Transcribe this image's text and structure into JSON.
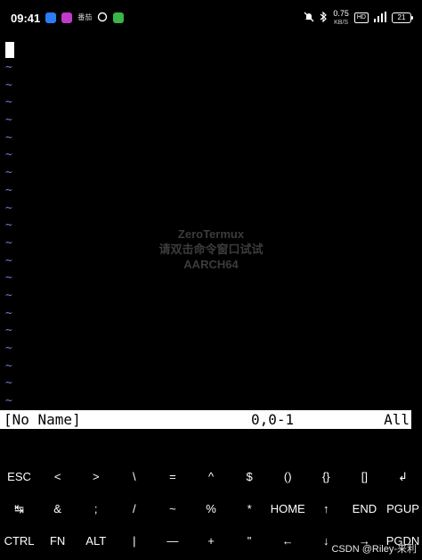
{
  "status_bar": {
    "time": "09:41",
    "notif_text": "番茄",
    "net_speed_value": "0.75",
    "net_speed_unit": "KB/S",
    "hd_badge": "HD",
    "battery_level": "21"
  },
  "editor": {
    "tilde_char": "~",
    "tilde_rows": 20,
    "watermark": {
      "line1": "ZeroTermux",
      "line2": "请双击命令窗口试试",
      "line3": "AARCH64"
    },
    "status_line": {
      "file_name": "[No Name]",
      "position": "0,0-1",
      "scroll": "All"
    }
  },
  "extra_keys": {
    "row1": [
      "ESC",
      "<",
      ">",
      "\\",
      "=",
      "^",
      "$",
      "()",
      "{}",
      "[]",
      "↲"
    ],
    "row2": [
      "↹",
      "&",
      ";",
      "/",
      "~",
      "%",
      "*",
      "HOME",
      "↑",
      "END",
      "PGUP"
    ],
    "row3": [
      "CTRL",
      "FN",
      "ALT",
      "|",
      "—",
      "+",
      "\"",
      "←",
      "↓",
      "→",
      "PGDN"
    ]
  },
  "credit": "CSDN @Riley-来利"
}
